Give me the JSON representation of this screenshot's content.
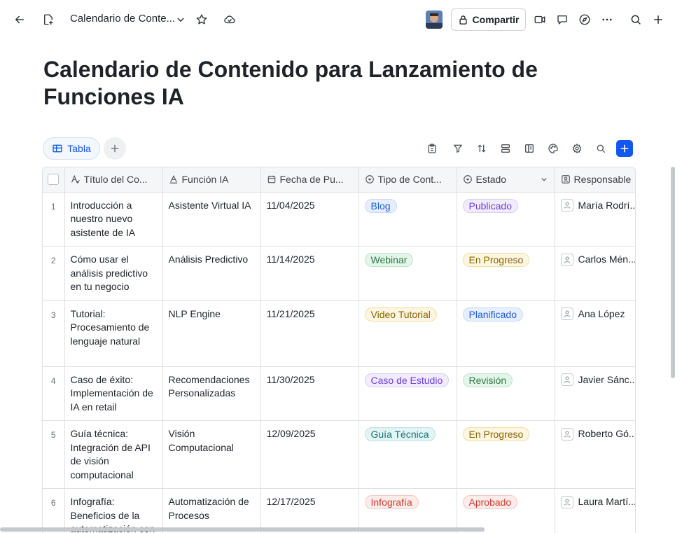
{
  "topbar": {
    "doc_title": "Calendario de Conte...",
    "share_label": "Compartir",
    "icons": [
      "arrow-left-icon",
      "new-doc-icon",
      "chevron-down-icon",
      "star-icon",
      "cloud-icon",
      "lock-icon",
      "video-icon",
      "comment-icon",
      "compass-icon",
      "more-icon",
      "search-icon",
      "plus-icon"
    ]
  },
  "page": {
    "title": "Calendario de Contenido para Lanzamiento de Funciones IA"
  },
  "views": {
    "active_tab": "Tabla"
  },
  "table": {
    "columns": [
      {
        "label": "Título del Co...",
        "icon": "text-ai-icon"
      },
      {
        "label": "Función IA",
        "icon": "text-icon"
      },
      {
        "label": "Fecha de Pu...",
        "icon": "calendar-icon"
      },
      {
        "label": "Tipo de Cont...",
        "icon": "select-icon"
      },
      {
        "label": "Estado",
        "icon": "select-icon"
      },
      {
        "label": "Responsable",
        "icon": "person-icon"
      }
    ],
    "rows": [
      {
        "n": "1",
        "titulo": "Introducción a nuestro nuevo asistente de IA",
        "funcion": "Asistente Virtual IA",
        "fecha": "11/04/2025",
        "tipo": "Blog",
        "tipo_color": "blue",
        "estado": "Publicado",
        "estado_color": "purple",
        "responsable": "María Rodrí..."
      },
      {
        "n": "2",
        "titulo": "Cómo usar el análisis predictivo en tu negocio",
        "funcion": "Análisis Predictivo",
        "fecha": "11/14/2025",
        "tipo": "Webinar",
        "tipo_color": "green",
        "estado": "En Progreso",
        "estado_color": "yellow",
        "responsable": "Carlos Mén..."
      },
      {
        "n": "3",
        "titulo": "Tutorial: Procesamiento de lenguaje natural",
        "funcion": "NLP Engine",
        "fecha": "11/21/2025",
        "tipo": "Video Tutorial",
        "tipo_color": "yellow",
        "estado": "Planificado",
        "estado_color": "blue",
        "responsable": "Ana López"
      },
      {
        "n": "4",
        "titulo": "Caso de éxito: Implementación de IA en retail",
        "funcion": "Recomendaciones Personalizadas",
        "fecha": "11/30/2025",
        "tipo": "Caso de Estudio",
        "tipo_color": "purple",
        "estado": "Revisión",
        "estado_color": "green",
        "responsable": "Javier Sánc..."
      },
      {
        "n": "5",
        "titulo": "Guía técnica: Integración de API de visión computacional",
        "funcion": "Visión Computacional",
        "fecha": "12/09/2025",
        "tipo": "Guía Técnica",
        "tipo_color": "teal",
        "estado": "En Progreso",
        "estado_color": "yellow",
        "responsable": "Roberto Gó..."
      },
      {
        "n": "6",
        "titulo": "Infografía: Beneficios de la automatización con IA",
        "funcion": "Automatización de Procesos",
        "fecha": "12/17/2025",
        "tipo": "Infografía",
        "tipo_color": "red",
        "estado": "Aprobado",
        "estado_color": "red",
        "responsable": "Laura Martí..."
      }
    ]
  },
  "colors": {
    "accent": "#1456f0",
    "header_bg": "#f5f6f7",
    "border": "#dee0e3"
  }
}
